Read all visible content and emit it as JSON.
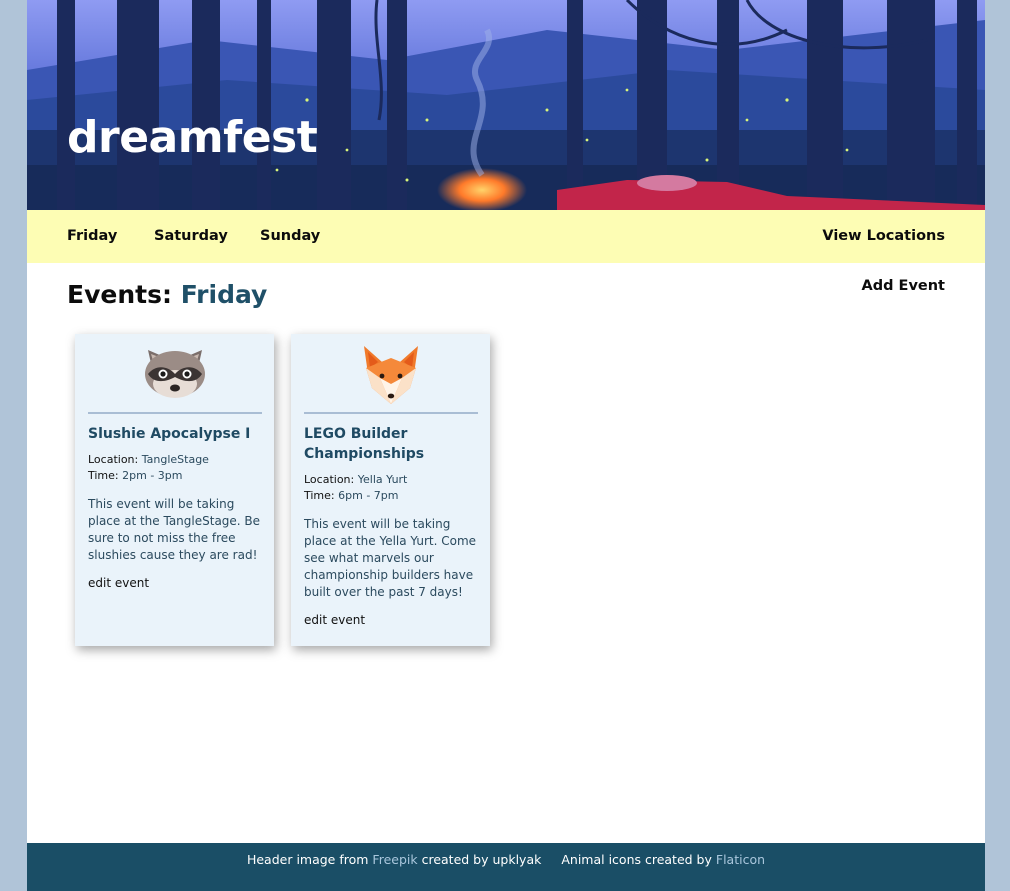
{
  "site": {
    "title": "dreamfest"
  },
  "nav": {
    "days": [
      "Friday",
      "Saturday",
      "Sunday"
    ],
    "view_locations": "View Locations"
  },
  "events_header": {
    "prefix": "Events:",
    "day": "Friday",
    "add_event": "Add Event"
  },
  "events": [
    {
      "animal": "raccoon-icon",
      "title": "Slushie Apocalypse I",
      "location_label": "Location:",
      "location": "TangleStage",
      "time_label": "Time:",
      "time": "2pm - 3pm",
      "description": "This event will be taking place at the TangleStage. Be sure to not miss the free slushies cause they are rad!",
      "edit_label": "edit event"
    },
    {
      "animal": "fox-icon",
      "title": "LEGO Builder Championships",
      "location_label": "Location:",
      "location": "Yella Yurt",
      "time_label": "Time:",
      "time": "6pm - 7pm",
      "description": "This event will be taking place at the Yella Yurt. Come see what marvels our championship builders have built over the past 7 days!",
      "edit_label": "edit event"
    }
  ],
  "footer": {
    "header_credit_prefix": "Header image from",
    "header_credit_link": "Freepik",
    "header_credit_suffix": "created by upklyak",
    "icon_credit_prefix": "Animal icons created by",
    "icon_credit_link": "Flaticon"
  },
  "colors": {
    "outer_background": "#b0c4d8",
    "nav_background": "#fdfdb4",
    "card_background": "#eaf3fa",
    "accent_day": "#1f5068",
    "footer_background": "#1a4e66"
  }
}
